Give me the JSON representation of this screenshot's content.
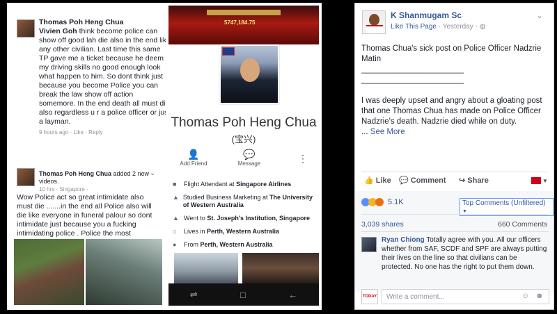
{
  "left": {
    "comment1": {
      "author": "Thomas Poh Heng Chua",
      "mention": "Vivien Goh",
      "text": " think become police can show off good lah die also in the end like any other civilian.  Last time this same TP gave me a ticket because he deem my driving skills no good enough look what happen to him. So dont think just because you become Police you can break the law show off action somemore. In the end death all must die also regardless u r a police officer or just a layman.",
      "time": "9 hours ago",
      "like": "Like",
      "reply": "Reply"
    },
    "post": {
      "author": "Thomas Poh Heng Chua",
      "action": " added 2 new videos.",
      "meta": "10 hrs · Singapore ·",
      "text": "Wow Police act so great intimidate also must die .......in the end all Police also will die like everyone in funeral palour so dont intimidate just because you a fucking intimidating police . Police the most rewarding"
    },
    "profile": {
      "banner_text": "5747,184.75",
      "name": "Thomas Poh Heng Chua",
      "chinese_name": "(宝兴)",
      "actions": [
        {
          "label": "Add Friend",
          "icon": "add-friend-icon"
        },
        {
          "label": "Message",
          "icon": "messenger-icon"
        }
      ],
      "details": [
        {
          "prefix": "Flight Attendant at ",
          "strong": "Singapore Airlines",
          "icon": "briefcase-icon"
        },
        {
          "prefix": "Studied Business Marketing at ",
          "strong": "The University of Western Australia",
          "icon": "graduation-cap-icon"
        },
        {
          "prefix": "Went to ",
          "strong": "St. Joseph's Institution, Singapore",
          "icon": "graduation-cap-icon"
        },
        {
          "prefix": "Lives in ",
          "strong": "Perth, Western Australia",
          "icon": "home-icon"
        },
        {
          "prefix": "From ",
          "strong": "Perth, Western Australia",
          "icon": "location-pin-icon"
        }
      ]
    }
  },
  "right": {
    "page_name": "K Shanmugam Sc",
    "like_page": "Like This Page",
    "time": "Yesterday",
    "post_title": "Thomas Chua's sick post on Police Officer Nadzrie Matin",
    "underline1": "_______________________",
    "underline2": "_______________________",
    "post_body": "I was deeply upset and angry about a gloating post that one Thomas Chua has made on Police Officer Nadzrie's death. Nadzrie died while on duty.",
    "ellipsis": "...",
    "see_more": "See More",
    "actions": {
      "like": "Like",
      "comment": "Comment",
      "share": "Share"
    },
    "reactions_count": "5.1K",
    "sort_label": "Top Comments (Unfiltered)",
    "shares": "3,039 shares",
    "comments_count": "660 Comments",
    "top_comment": {
      "author": "Ryan Chiong",
      "text": " Totally agree with you. All our officers whether from SAF, SCDF and SPF are always putting their lives on the line so that civilians can be protected. No one has the right to put them down."
    },
    "writer_logo": "TODAY",
    "write_placeholder": "Write a comment...",
    "colors": {
      "fb_blue": "#365899",
      "reaction_like": "#5890ff",
      "reaction_angry": "#e9710f",
      "today_red": "#d0021b"
    }
  }
}
